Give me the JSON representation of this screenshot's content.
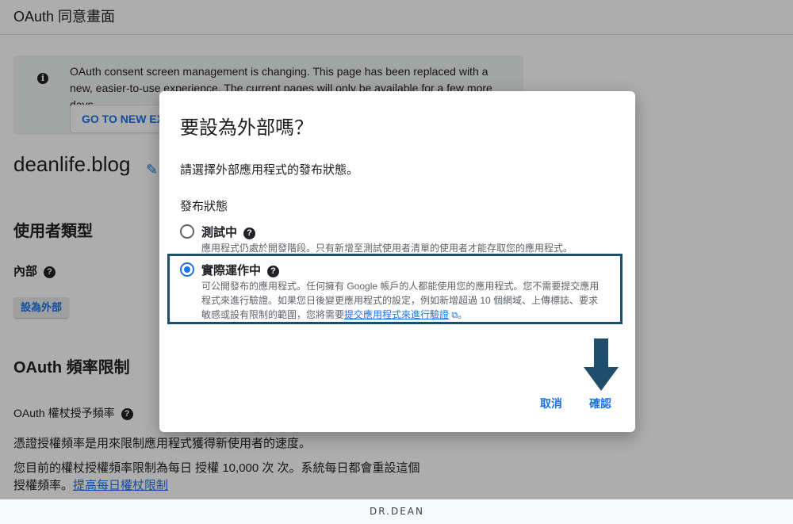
{
  "page": {
    "title": "OAuth 同意畫面",
    "banner": {
      "text": "OAuth consent screen management is changing. This page has been replaced with a new, easier-to-use experience. The current pages will only be available for a few more days.",
      "button": "GO TO NEW EXPERIENCE"
    },
    "app_name": "deanlife.blog",
    "user_type_heading": "使用者類型",
    "user_type_value": "內部",
    "make_external_button": "設為外部",
    "rate_limit_heading": "OAuth 頻率限制",
    "grant_rate_label": "OAuth 權杖授予頻率",
    "para1": "憑證授權頻率是用來限制應用程式獲得新使用者的速度。",
    "para2": "您目前的權杖授權頻率限制為每日 授權 10,000 次 次。系統每日都會重設這個",
    "para3_prefix": "授權頻率。",
    "para3_link": "提高每日權杖限制"
  },
  "dialog": {
    "title": "要設為外部嗎？",
    "description": "請選擇外部應用程式的發布狀態。",
    "status_label": "發布狀態",
    "options": [
      {
        "label": "測試中",
        "description": "應用程式仍處於開發階段。只有新增至測試使用者清單的使用者才能存取您的應用程式。",
        "selected": false
      },
      {
        "label": "實際運作中",
        "description": "可公開發布的應用程式。任何擁有 Google 帳戶的人都能使用您的應用程式。您不需要提交應用程式來進行驗證。如果您日後變更應用程式的設定，例如新增超過 10 個網域、上傳標誌、要求敏感或設有限制的範圍，您將需要",
        "link": "提交應用程式來進行驗證",
        "suffix": "。",
        "selected": true
      }
    ],
    "cancel": "取消",
    "confirm": "確認"
  },
  "footer": {
    "logo": "DR.DEAN"
  },
  "colors": {
    "accent": "#1a73e8",
    "highlight_border": "#1f4e6b",
    "arrow": "#1f4e6b"
  },
  "icons": [
    "info-icon",
    "edit-icon",
    "help-icon",
    "external-link-icon",
    "down-arrow-icon"
  ]
}
